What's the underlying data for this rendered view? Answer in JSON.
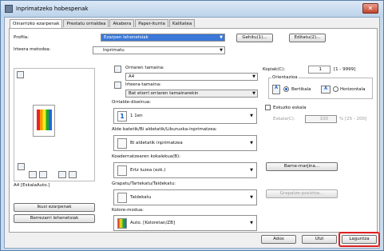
{
  "window": {
    "title": "Inprimatzeko hobespenak"
  },
  "tabs": [
    "Oinarrizko ezarpenak",
    "Prestatu orrialdea",
    "Akabera",
    "Paper-iturria",
    "Kalitatea"
  ],
  "profile": {
    "label": "Profila:",
    "value": "Ezarpen lehenetsiak",
    "add_label": "Gehitu(1)...",
    "edit_label": "Editatu(2)..."
  },
  "output": {
    "label": "Irteera metodoa:",
    "value": "Inprimatu"
  },
  "preview": {
    "caption": "A4 [EskalaAuto.]"
  },
  "left_buttons": {
    "view_settings": "Ikusi ezarpenak",
    "restore_defaults": "Berrezarri lehenetsiak"
  },
  "page_size": {
    "label": "Orriaren tamaina:",
    "value": "A4"
  },
  "output_size": {
    "label": "Irteera-tamaina:",
    "value": "Bat etorri orriaren tamainarekin"
  },
  "layout": {
    "label": "Orrialde-diseinua:",
    "value": "1 1en"
  },
  "duplex": {
    "label": "Alde batetik/Bi aldetatik/Liburuxka-inprimatzea:",
    "value": "Bi aldetatik inprimatzea"
  },
  "binding": {
    "label": "Koadernatzearen kokalekua(B):",
    "value": "Ertz luzea (ezk.)",
    "margin_button": "Barne-marjina..."
  },
  "stapling": {
    "label": "Grapatu/Tartekatu/Taldekatu:",
    "value": "Taldekatu",
    "stapling_button": "Grapatze-posizioa..."
  },
  "color": {
    "label": "Kolore-modua:",
    "value": "Auto. [Koloretan/ZB]"
  },
  "copies": {
    "label": "Kopiak(C):",
    "value": "1",
    "range": "[1 - 9999]"
  },
  "orientation": {
    "label": "Orientazioa",
    "portrait": "Bertikala",
    "landscape": "Horizontala"
  },
  "scaling": {
    "label": "Eskuzko eskala",
    "field_label": "Eskala(C):",
    "value": "100",
    "range": "% [25 - 200]"
  },
  "footer": {
    "ok": "Ados",
    "cancel": "Utzi",
    "help": "Laguntza"
  }
}
